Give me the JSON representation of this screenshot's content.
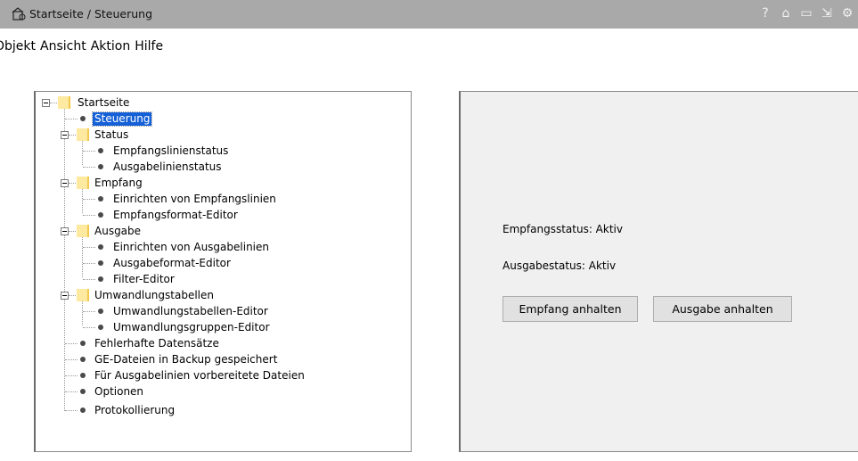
{
  "window": {
    "title": "Startseite / Steuerung"
  },
  "title_actions": [
    {
      "name": "help-icon",
      "glyph": "?"
    },
    {
      "name": "home-icon",
      "glyph": "⌂"
    },
    {
      "name": "folder-icon",
      "glyph": "▭"
    },
    {
      "name": "exit-icon",
      "glyph": "⇲"
    },
    {
      "name": "settings-icon",
      "glyph": "⚙"
    }
  ],
  "menu": {
    "objekt": "Objekt",
    "ansicht": "Ansicht",
    "aktion": "Aktion",
    "hilfe": "Hilfe"
  },
  "tree": {
    "root": "Startseite",
    "steuerung": "Steuerung",
    "status": "Status",
    "empfangslinienstatus": "Empfangslinienstatus",
    "ausgabelinienstatus": "Ausgabelinienstatus",
    "empfang": "Empfang",
    "einrichten_empfangslinien": "Einrichten von Empfangslinien",
    "empfangsformat_editor": "Empfangsformat-Editor",
    "ausgabe": "Ausgabe",
    "einrichten_ausgabelinien": "Einrichten von Ausgabelinien",
    "ausgabeformat_editor": "Ausgabeformat-Editor",
    "filter_editor": "Filter-Editor",
    "umwandlungstabellen": "Umwandlungstabellen",
    "umwandlungstabellen_editor": "Umwandlungstabellen-Editor",
    "umwandlungsgruppen_editor": "Umwandlungsgruppen-Editor",
    "fehlerhafte_datensaetze": "Fehlerhafte Datensätze",
    "ge_dateien_backup": "GE-Dateien in Backup gespeichert",
    "fuer_ausgabelinien_dateien": "Für Ausgabelinien vorbereitete Dateien",
    "optionen": "Optionen",
    "protokollierung": "Protokollierung"
  },
  "control": {
    "empfangsstatus": "Empfangsstatus: Aktiv",
    "ausgabestatus": "Ausgabestatus: Aktiv",
    "empfang_anhalten": "Empfang anhalten",
    "ausgabe_anhalten": "Ausgabe anhalten"
  }
}
